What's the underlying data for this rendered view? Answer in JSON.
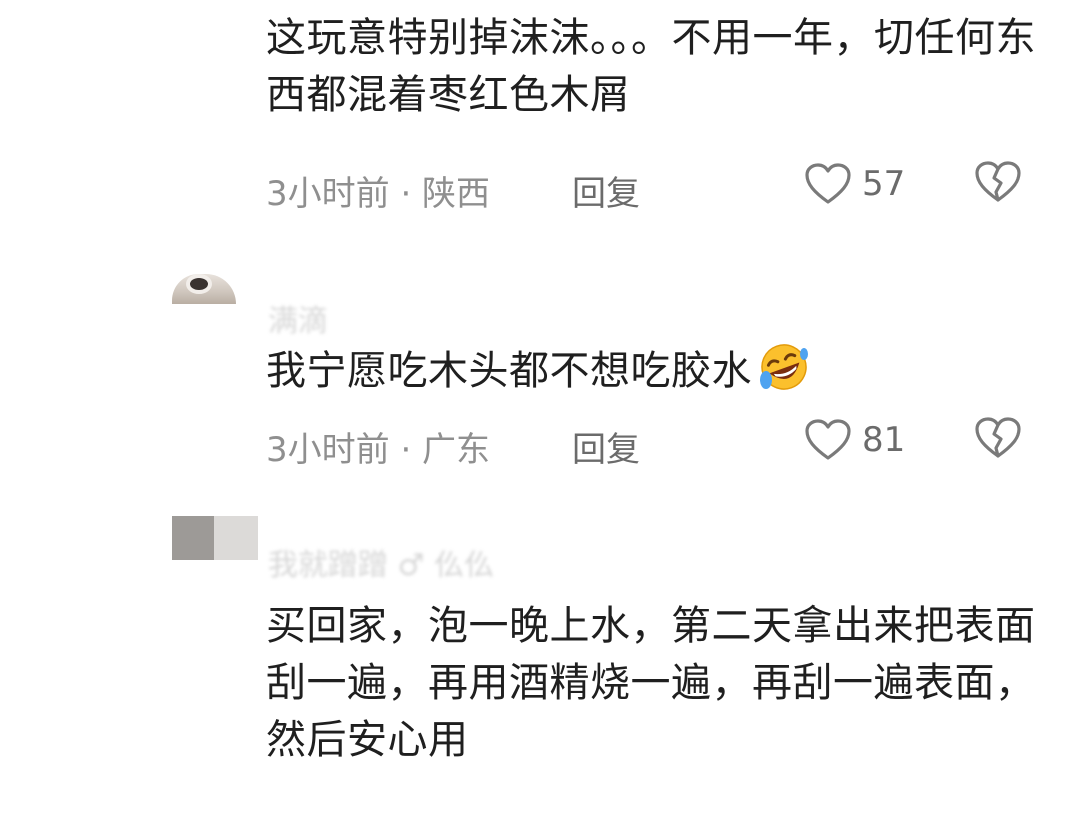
{
  "comments": [
    {
      "text": "这玩意特别掉沫沫。。。不用一年，切任何东西都混着枣红色木屑",
      "time_location": "3小时前 · 陕西",
      "reply_label": "回复",
      "like_count": "57"
    },
    {
      "username": "满滴",
      "text": "我宁愿吃木头都不想吃胶水",
      "emoji": "rolling-on-floor-laughing-emoji",
      "time_location": "3小时前 · 广东",
      "reply_label": "回复",
      "like_count": "81"
    },
    {
      "username": "我就蹭蹭 ♂ 仫仫",
      "text": "买回家，泡一晚上水，第二天拿出来把表面刮一遍，再用酒精烧一遍，再刮一遍表面，然后安心用"
    }
  ],
  "icons": {
    "like": "heart-outline-icon",
    "dislike": "broken-heart-icon"
  },
  "colors": {
    "text": "#1f1f1f",
    "meta": "#8f8f8f",
    "icon": "#7a7a7a",
    "background": "#ffffff"
  }
}
